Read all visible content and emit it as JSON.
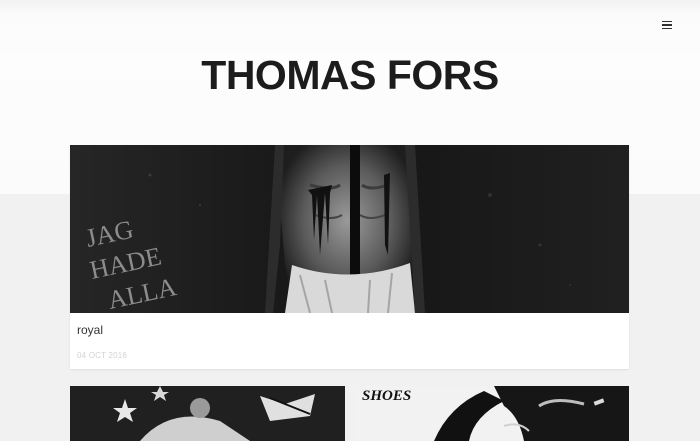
{
  "header": {
    "title": "THOMAS FORS",
    "menu_icon": "hamburger-menu-icon"
  },
  "posts": [
    {
      "title": "royal",
      "date": "04 OCT 2016",
      "image_text": [
        "JAG",
        "HADE",
        "ALLA"
      ]
    }
  ],
  "thumbnails": {
    "right_text": "SHOES"
  },
  "colors": {
    "page_bg": "#f1f1f1",
    "title": "#1c1c1c",
    "date": "#d2d2d2"
  }
}
